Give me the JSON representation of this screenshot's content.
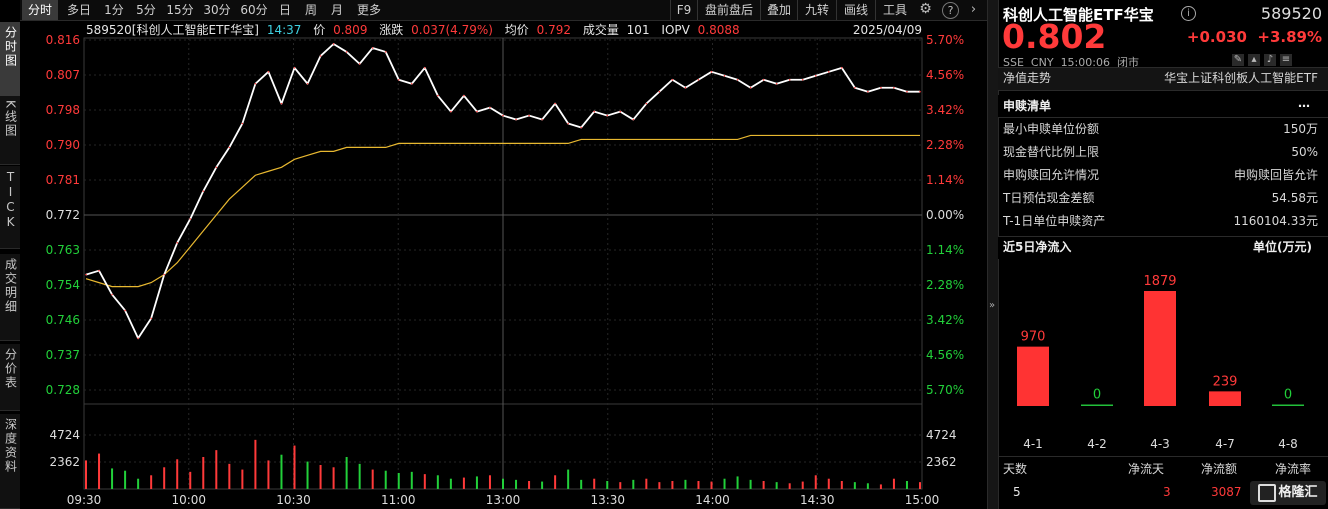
{
  "toolbar": {
    "tabs": [
      "分时",
      "多日",
      "1分",
      "5分",
      "15分",
      "30分",
      "60分",
      "日",
      "周",
      "月",
      "更多"
    ],
    "right": [
      "F9",
      "盘前盘后",
      "叠加",
      "九转",
      "画线",
      "工具"
    ],
    "icons": [
      "settings-icon",
      "help-icon",
      "next-icon"
    ]
  },
  "side_tabs": [
    "分时图",
    "K线图",
    "TICK",
    "成交明细",
    "分价表",
    "深度资料"
  ],
  "infobar": {
    "code_name": "589520[科创人工智能ETF华宝]",
    "time": "14:37",
    "price_label": "价",
    "price": "0.809",
    "chg_label": "涨跌",
    "chg": "0.037(4.79%)",
    "avg_label": "均价",
    "avg": "0.792",
    "vol_label": "成交量",
    "vol": "101",
    "iopv_label": "IOPV",
    "iopv": "0.8088",
    "date": "2025/04/09"
  },
  "price_axis": {
    "left": [
      "0.816",
      "0.807",
      "0.798",
      "0.790",
      "0.781",
      "0.772",
      "0.763",
      "0.754",
      "0.746",
      "0.737",
      "0.728"
    ],
    "right": [
      "5.70%",
      "4.56%",
      "3.42%",
      "2.28%",
      "1.14%",
      "0.00%",
      "1.14%",
      "2.28%",
      "3.42%",
      "4.56%",
      "5.70%"
    ]
  },
  "vol_axis": {
    "left": [
      "4724",
      "2362"
    ],
    "right": [
      "4724",
      "2362"
    ]
  },
  "time_axis": [
    "09:30",
    "10:00",
    "10:30",
    "11:00",
    "13:00",
    "13:30",
    "14:00",
    "14:30",
    "15:00"
  ],
  "colors": {
    "up": "#ff3a3a",
    "down": "#22d03a",
    "price_line": "#ffffff",
    "avg_line": "#e8b830",
    "bg": "#000000"
  },
  "chart_data": {
    "type": "line",
    "title": "",
    "series": [
      {
        "name": "价",
        "values": [
          0.757,
          0.758,
          0.752,
          0.748,
          0.741,
          0.746,
          0.757,
          0.765,
          0.771,
          0.778,
          0.784,
          0.789,
          0.795,
          0.805,
          0.808,
          0.8,
          0.809,
          0.805,
          0.812,
          0.815,
          0.813,
          0.81,
          0.814,
          0.813,
          0.806,
          0.805,
          0.809,
          0.802,
          0.798,
          0.802,
          0.798,
          0.799,
          0.797,
          0.796,
          0.797,
          0.796,
          0.8,
          0.795,
          0.794,
          0.798,
          0.797,
          0.798,
          0.796,
          0.8,
          0.803,
          0.806,
          0.804,
          0.806,
          0.808,
          0.807,
          0.806,
          0.804,
          0.806,
          0.805,
          0.806,
          0.806,
          0.807,
          0.808,
          0.809,
          0.804,
          0.803,
          0.804,
          0.804,
          0.803,
          0.803
        ]
      },
      {
        "name": "均价",
        "values": [
          0.756,
          0.755,
          0.754,
          0.754,
          0.754,
          0.755,
          0.757,
          0.76,
          0.764,
          0.768,
          0.772,
          0.776,
          0.779,
          0.782,
          0.783,
          0.784,
          0.786,
          0.787,
          0.788,
          0.788,
          0.789,
          0.789,
          0.789,
          0.789,
          0.79,
          0.79,
          0.79,
          0.79,
          0.79,
          0.79,
          0.79,
          0.79,
          0.79,
          0.79,
          0.79,
          0.79,
          0.79,
          0.79,
          0.791,
          0.791,
          0.791,
          0.791,
          0.791,
          0.791,
          0.791,
          0.791,
          0.791,
          0.791,
          0.791,
          0.791,
          0.791,
          0.792,
          0.792,
          0.792,
          0.792,
          0.792,
          0.792,
          0.792,
          0.792,
          0.792,
          0.792,
          0.792,
          0.792,
          0.792,
          0.792
        ]
      }
    ],
    "volume_bars": [
      2500,
      3100,
      1800,
      1600,
      900,
      1200,
      1900,
      2600,
      1500,
      2800,
      3400,
      2200,
      1700,
      4300,
      2500,
      3000,
      3800,
      2400,
      2100,
      1900,
      2800,
      2200,
      1700,
      1600,
      1400,
      1500,
      1300,
      1200,
      900,
      1000,
      1100,
      1200,
      900,
      800,
      700,
      650,
      1200,
      1700,
      800,
      900,
      700,
      600,
      800,
      900,
      600,
      700,
      800,
      700,
      650,
      900,
      1100,
      800,
      700,
      600,
      500,
      650,
      1200,
      900,
      700,
      600,
      500,
      400,
      900,
      700,
      600
    ],
    "ylim": [
      0.728,
      0.816
    ],
    "prev_close": 0.772
  },
  "quote": {
    "name": "科创人工智能ETF华宝",
    "code": "589520",
    "price": "0.802",
    "chg": "+0.030",
    "pct": "+3.89%",
    "market": "SSE",
    "currency": "CNY",
    "time": "15:00:06",
    "status": "闭市"
  },
  "nav_row": {
    "label": "净值走势",
    "value": "华宝上证科创板人工智能ETF"
  },
  "subscription": {
    "title": "申赎清单",
    "more": "⋯",
    "rows": [
      {
        "k": "最小申赎单位份额",
        "v": "150万"
      },
      {
        "k": "现金替代比例上限",
        "v": "50%"
      },
      {
        "k": "申购赎回允许情况",
        "v": "申购赎回皆允许"
      },
      {
        "k": "T日预估现金差额",
        "v": "54.58元"
      },
      {
        "k": "T-1日单位申赎资产",
        "v": "1160104.33元"
      }
    ]
  },
  "inflow": {
    "title": "近5日净流入",
    "unit": "单位(万元)",
    "dates": [
      "4-1",
      "4-2",
      "4-3",
      "4-7",
      "4-8"
    ],
    "values": [
      970,
      0,
      1879,
      239,
      0
    ],
    "labels": [
      "970",
      "0",
      "1879",
      "239",
      "0"
    ]
  },
  "footer": {
    "headers": [
      "天数",
      "净流天",
      "净流额",
      "净流率"
    ],
    "values": [
      "5",
      "3",
      "3087",
      ""
    ],
    "watermark": "格隆汇"
  }
}
